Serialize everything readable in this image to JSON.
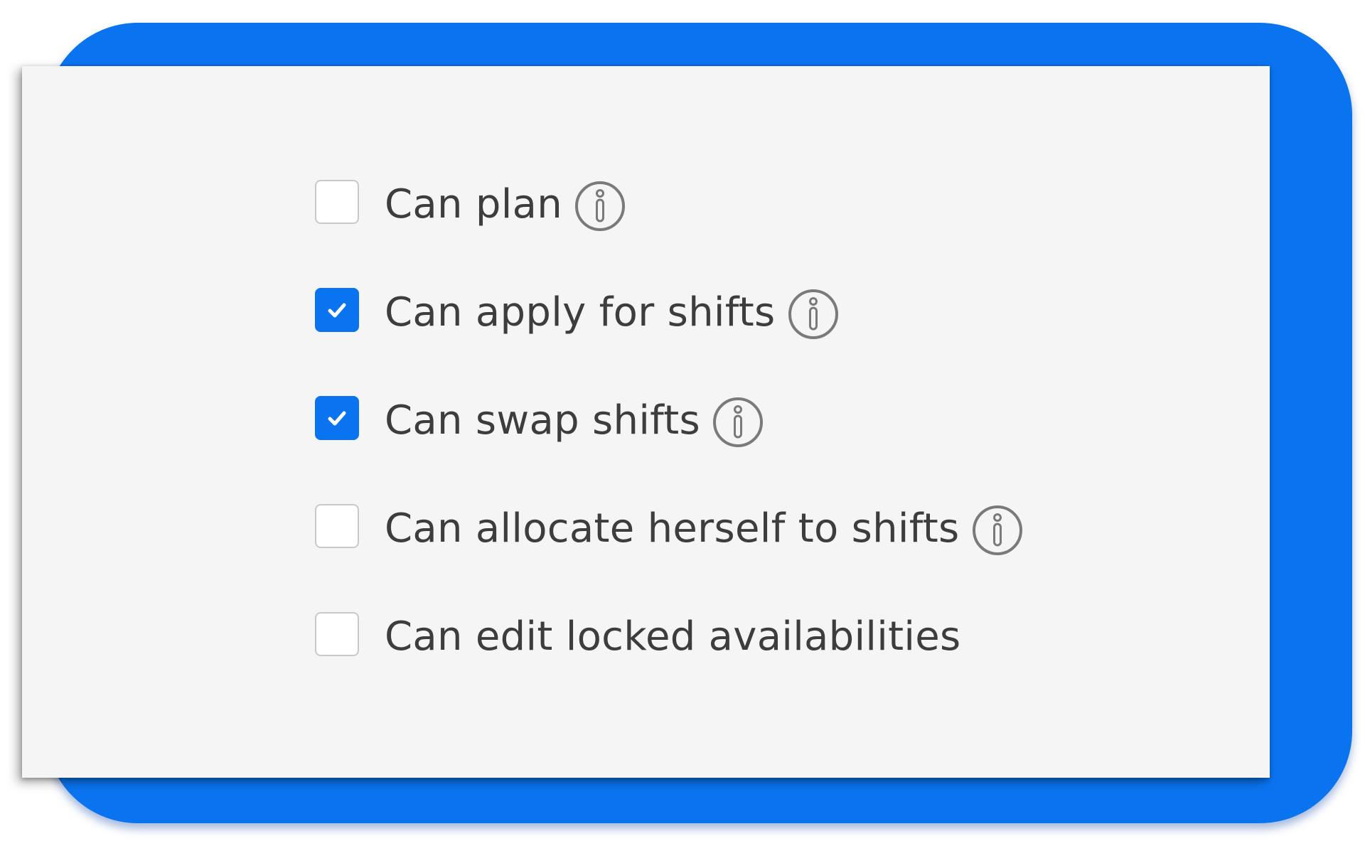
{
  "colors": {
    "accent": "#0a74f0",
    "panel_background": "#f5f5f5",
    "label_text": "#3d3d3d",
    "icon_stroke": "#7a7a7a",
    "checkbox_border": "#c9c9c9"
  },
  "permissions": [
    {
      "label": "Can plan",
      "checked": false,
      "info_icon": "info-circle-icon"
    },
    {
      "label": "Can apply for shifts",
      "checked": true,
      "info_icon": "info-circle-icon"
    },
    {
      "label": "Can swap shifts",
      "checked": true,
      "info_icon": "info-circle-icon"
    },
    {
      "label": "Can allocate herself to shifts",
      "checked": false,
      "info_icon": "info-circle-icon"
    },
    {
      "label": "Can edit locked availabilities",
      "checked": false,
      "info_icon": null
    }
  ]
}
